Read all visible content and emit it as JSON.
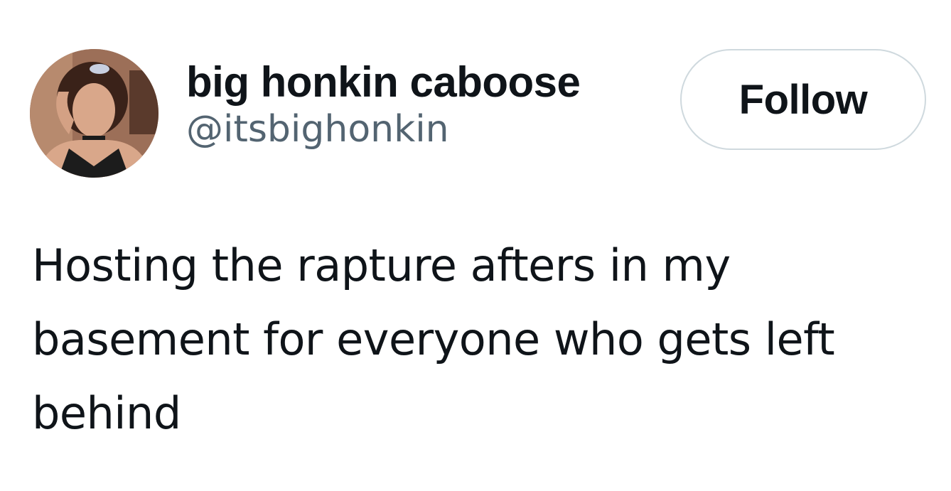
{
  "tweet": {
    "author": {
      "display_name": "big honkin caboose",
      "handle": "@itsbighonkin",
      "avatar_alt": "profile photo"
    },
    "follow_button": {
      "label": "Follow"
    },
    "text": "Hosting the rapture afters in my basement for everyone who gets left behind"
  },
  "colors": {
    "text_primary": "#0f1419",
    "text_secondary": "#536471",
    "button_border": "#cfd9de",
    "background": "#ffffff"
  }
}
